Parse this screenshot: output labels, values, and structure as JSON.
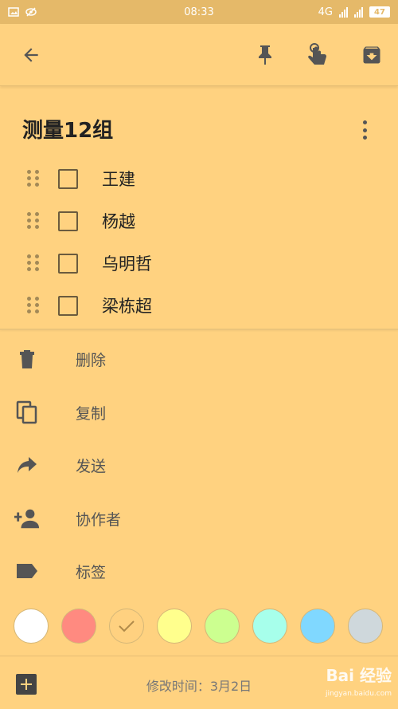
{
  "status_bar": {
    "time": "08:33",
    "network": "4G",
    "battery": "47"
  },
  "toolbar": {
    "back_icon": "arrow-left-icon",
    "pin_icon": "pin-icon",
    "reminder_icon": "hand-pointer-icon",
    "archive_icon": "archive-icon"
  },
  "note": {
    "title": "测量12组",
    "items": [
      {
        "label": "王建",
        "checked": false
      },
      {
        "label": "杨越",
        "checked": false
      },
      {
        "label": "乌明哲",
        "checked": false
      },
      {
        "label": "梁栋超",
        "checked": false
      }
    ]
  },
  "menu": [
    {
      "label": "删除",
      "icon": "trash-icon"
    },
    {
      "label": "复制",
      "icon": "copy-icon"
    },
    {
      "label": "发送",
      "icon": "share-icon"
    },
    {
      "label": "协作者",
      "icon": "add-person-icon"
    },
    {
      "label": "标签",
      "icon": "label-icon"
    }
  ],
  "colors": {
    "background": "#FFD280",
    "swatches": [
      "#FFFFFF",
      "#FF8A80",
      "#FFD180",
      "#FFFF8D",
      "#CCFF90",
      "#A7FFEB",
      "#80D8FF",
      "#CFD8DC"
    ],
    "selected_index": 2
  },
  "footer": {
    "modified": "修改时间：3月2日",
    "watermark": "Bai 经验",
    "watermark_sub": "jingyan.baidu.com"
  }
}
